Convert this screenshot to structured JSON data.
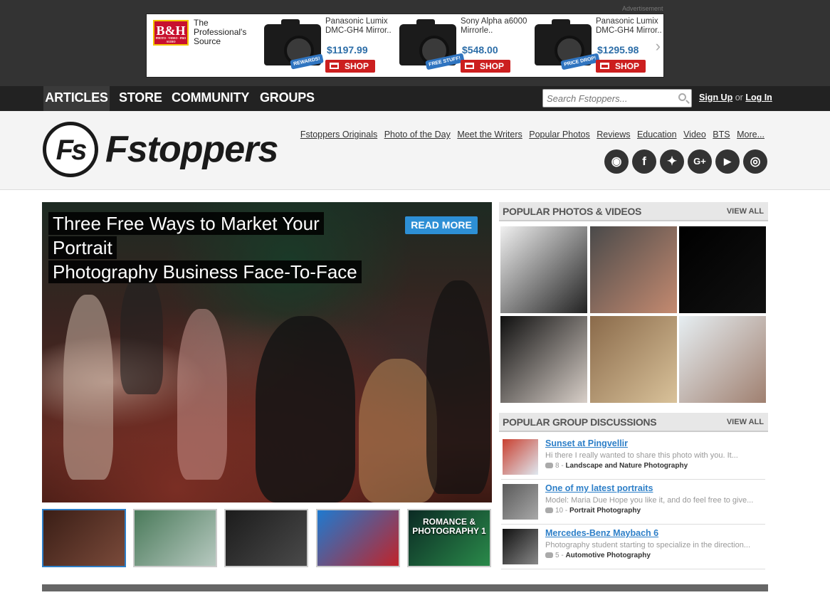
{
  "ad": {
    "label": "Advertisement",
    "logo": "B&H",
    "logo_sub": "PHOTO · VIDEO · PRO AUDIO",
    "tagline": "The Professional's Source",
    "products": [
      {
        "name": "Panasonic Lumix DMC-GH4 Mirror..",
        "price": "$1197.99",
        "badge": "REWARDS!",
        "shop": "SHOP"
      },
      {
        "name": "Sony Alpha a6000 Mirrorle..",
        "price": "$548.00",
        "badge": "FREE STUFF!",
        "shop": "SHOP"
      },
      {
        "name": "Panasonic Lumix DMC-GH4 Mirror..",
        "price": "$1295.98",
        "badge": "PRICE DROP!",
        "shop": "SHOP"
      }
    ],
    "next_icon": "chevron-right-icon"
  },
  "nav": {
    "items": [
      "ARTICLES",
      "STORE",
      "COMMUNITY",
      "GROUPS"
    ],
    "search_placeholder": "Search Fstoppers...",
    "signup": "Sign Up",
    "or": "or",
    "login": "Log In"
  },
  "header": {
    "logo_mark": "Fs",
    "logo_text": "Fstoppers",
    "links": [
      "Fstoppers Originals",
      "Photo of the Day",
      "Meet the Writers",
      "Popular Photos",
      "Reviews",
      "Education",
      "Video",
      "BTS",
      "More..."
    ],
    "socials": [
      {
        "icon": "rss-icon",
        "glyph": "◉"
      },
      {
        "icon": "facebook-icon",
        "glyph": "f"
      },
      {
        "icon": "twitter-icon",
        "glyph": "✦"
      },
      {
        "icon": "google-plus-icon",
        "glyph": "G+"
      },
      {
        "icon": "youtube-icon",
        "glyph": "▶"
      },
      {
        "icon": "instagram-icon",
        "glyph": "◎"
      }
    ]
  },
  "hero": {
    "title_line1": "Three Free Ways to Market Your Portrait",
    "title_line2": "Photography Business Face-To-Face",
    "read_more": "READ MORE"
  },
  "thumbnails": [
    {
      "label": "",
      "colors": [
        "#3a1e16",
        "#7a4a3a"
      ]
    },
    {
      "label": "",
      "colors": [
        "#4a7a5a",
        "#b7c9c0"
      ]
    },
    {
      "label": "",
      "colors": [
        "#1c1c1c",
        "#4a4a4a"
      ]
    },
    {
      "label": "",
      "colors": [
        "#1e7ad0",
        "#c0242a"
      ]
    },
    {
      "label": "ROMANCE & PHOTOGRAPHY 1",
      "colors": [
        "#0b2a24",
        "#2a8a4a"
      ]
    }
  ],
  "popular": {
    "title": "POPULAR PHOTOS & VIDEOS",
    "view_all": "VIEW ALL",
    "photos": [
      {
        "colors": [
          "#f0f0f0",
          "#222"
        ]
      },
      {
        "colors": [
          "#4a4a4a",
          "#c48a70"
        ]
      },
      {
        "colors": [
          "#000",
          "#111"
        ]
      },
      {
        "colors": [
          "#0f0f0f",
          "#d8cfc8"
        ]
      },
      {
        "colors": [
          "#8a6a4a",
          "#d9c29a"
        ]
      },
      {
        "colors": [
          "#e6eef2",
          "#a08070"
        ]
      }
    ]
  },
  "groups": {
    "title": "POPULAR GROUP DISCUSSIONS",
    "view_all": "VIEW ALL",
    "items": [
      {
        "title": "Sunset at Pingvellir",
        "excerpt": "Hi there I really wanted to share this photo with you. It...",
        "count": "8",
        "group": "Landscape and Nature Photography",
        "colors": [
          "#c94030",
          "#dfe8f0"
        ]
      },
      {
        "title": "One of my latest portraits",
        "excerpt": "Model: Maria Due Hope you like it, and do feel free to give...",
        "count": "10",
        "group": "Portrait Photography",
        "colors": [
          "#5a5a5a",
          "#a8a8a8"
        ]
      },
      {
        "title": "Mercedes-Benz Maybach 6",
        "excerpt": "Photography student starting to specialize in the direction...",
        "count": "5",
        "group": "Automotive Photography",
        "colors": [
          "#111",
          "#888"
        ]
      }
    ]
  }
}
